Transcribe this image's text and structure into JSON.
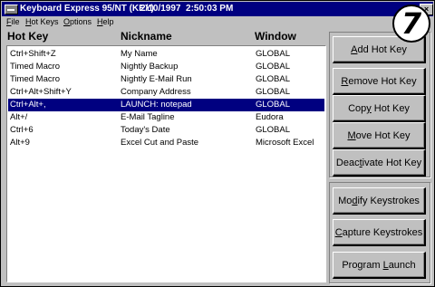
{
  "window": {
    "title": "Keyboard Express 95/NT (KEY)",
    "datetime": "2/10/1997  2:50:03 PM",
    "close_glyph": "×"
  },
  "badge_number": "7",
  "menu": [
    {
      "label": "File",
      "ul": "F",
      "rest": "ile"
    },
    {
      "label": "Hot Keys",
      "ul": "H",
      "rest": "ot Keys"
    },
    {
      "label": "Options",
      "ul": "O",
      "rest": "ptions"
    },
    {
      "label": "Help",
      "ul": "H",
      "rest": "elp"
    }
  ],
  "columns": [
    "Hot Key",
    "Nickname",
    "Window"
  ],
  "rows": [
    {
      "hotkey": "Ctrl+Shift+Z",
      "nickname": "My Name",
      "window": "GLOBAL",
      "selected": false
    },
    {
      "hotkey": "Timed Macro",
      "nickname": "Nightly Backup",
      "window": "GLOBAL",
      "selected": false
    },
    {
      "hotkey": "Timed Macro",
      "nickname": "Nightly E-Mail Run",
      "window": "GLOBAL",
      "selected": false
    },
    {
      "hotkey": "Ctrl+Alt+Shift+Y",
      "nickname": "Company Address",
      "window": "GLOBAL",
      "selected": false
    },
    {
      "hotkey": "Ctrl+Alt+,",
      "nickname": "LAUNCH: notepad",
      "window": "GLOBAL",
      "selected": true
    },
    {
      "hotkey": "Alt+/",
      "nickname": "E-Mail Tagline",
      "window": "Eudora",
      "selected": false
    },
    {
      "hotkey": "Ctrl+6",
      "nickname": "Today's Date",
      "window": "GLOBAL",
      "selected": false
    },
    {
      "hotkey": "Alt+9",
      "nickname": "Excel Cut and Paste",
      "window": "Microsoft Excel",
      "selected": false
    }
  ],
  "buttons": {
    "add": {
      "pre": "",
      "ul": "A",
      "post": "dd Hot Key"
    },
    "remove": {
      "pre": "",
      "ul": "R",
      "post": "emove Hot Key"
    },
    "copy": {
      "pre": "Cop",
      "ul": "y",
      "post": " Hot Key"
    },
    "move": {
      "pre": "",
      "ul": "M",
      "post": "ove Hot Key"
    },
    "deactivate": {
      "pre": "Deac",
      "ul": "t",
      "post": "ivate Hot Key"
    },
    "modify": {
      "pre": "Mo",
      "ul": "d",
      "post": "ify Keystrokes"
    },
    "capture": {
      "pre": "",
      "ul": "C",
      "post": "apture Keystrokes"
    },
    "launch": {
      "pre": "Program ",
      "ul": "L",
      "post": "aunch"
    }
  }
}
